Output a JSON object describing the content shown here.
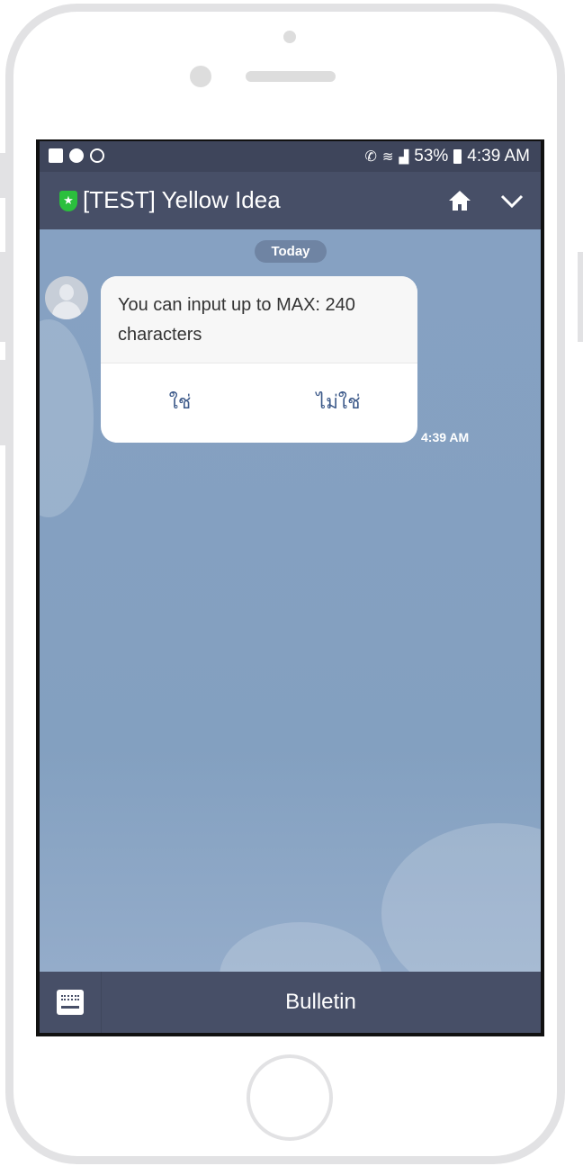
{
  "status_bar": {
    "battery": "53%",
    "time": "4:39 AM"
  },
  "header": {
    "title": "[TEST] Yellow Idea"
  },
  "chat": {
    "date_label": "Today",
    "message": {
      "text": "You can input up to MAX: 240 characters",
      "options": [
        "ใช่",
        "ไม่ใช่"
      ],
      "time": "4:39 AM"
    }
  },
  "bottom_bar": {
    "label": "Bulletin"
  },
  "colors": {
    "header": "#474f67",
    "chat_bg": "#84a0c0",
    "shield": "#2bbf3d"
  }
}
